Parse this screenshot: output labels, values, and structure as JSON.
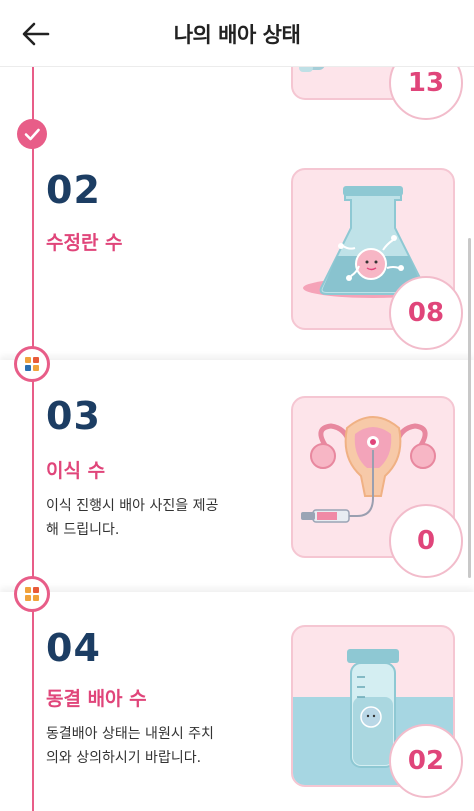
{
  "header": {
    "title": "나의 배아 상태",
    "back_icon": "arrow-left-icon"
  },
  "colors": {
    "accent": "#e85d88",
    "number": "#1c3d63",
    "card_bg": "#fde4ea"
  },
  "items": [
    {
      "count": "13"
    },
    {
      "number": "02",
      "label": "수정란 수",
      "count": "08",
      "icon": "flask-icon"
    },
    {
      "number": "03",
      "label": "이식 수",
      "description_line1": "이식 진행시 배아 사진을 제공",
      "description_line2": "해 드립니다.",
      "count": "0",
      "icon": "uterus-icon"
    },
    {
      "number": "04",
      "label": "동결 배아 수",
      "description_line1": "동결배아 상태는 내원시 주치",
      "description_line2": "의와 상의하시기 바랍니다.",
      "count": "02",
      "icon": "cryo-tube-icon"
    }
  ]
}
